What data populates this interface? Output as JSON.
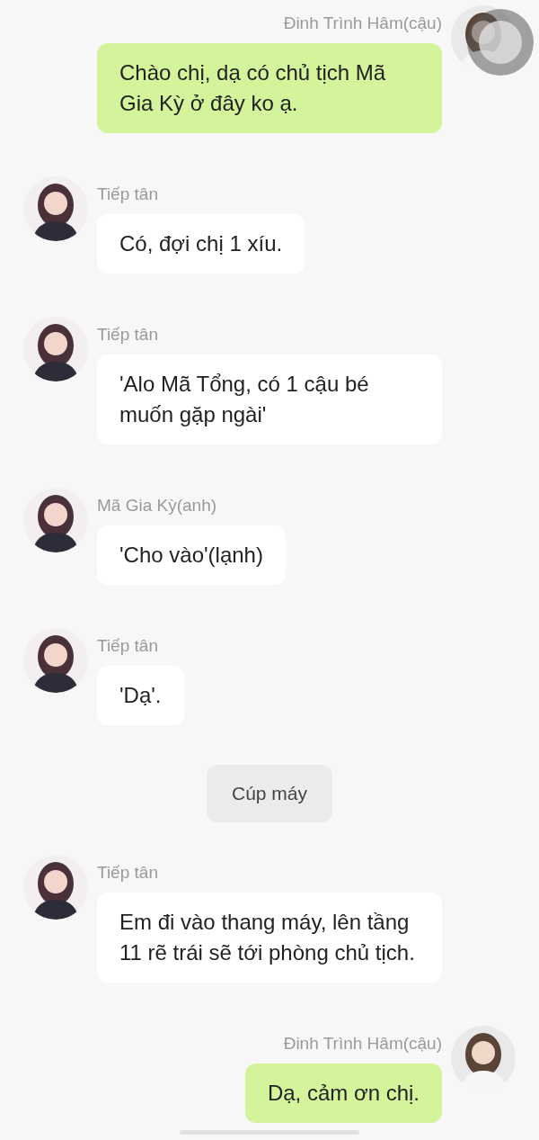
{
  "messages": [
    {
      "kind": "outgoing",
      "sender": "Đinh Trình Hâm(cậu)",
      "text": "Chào chị, dạ có chủ tịch Mã Gia Kỳ ở đây ko ạ."
    },
    {
      "kind": "incoming",
      "sender": "Tiếp tân",
      "text": "Có, đợi chị 1 xíu."
    },
    {
      "kind": "incoming",
      "sender": "Tiếp tân",
      "text": "'Alo Mã Tổng, có 1 cậu bé muốn gặp ngài'"
    },
    {
      "kind": "incoming",
      "sender": "Mã Gia Kỳ(anh)",
      "text": "'Cho vào'(lạnh)"
    },
    {
      "kind": "incoming",
      "sender": "Tiếp tân",
      "text": "'Dạ'."
    },
    {
      "kind": "system",
      "text": "Cúp máy"
    },
    {
      "kind": "incoming",
      "sender": "Tiếp tân",
      "text": "Em đi vào thang máy, lên tầng 11 rẽ trái sẽ tới phòng chủ tịch."
    },
    {
      "kind": "outgoing",
      "sender": "Đinh Trình Hâm(cậu)",
      "text": "Dạ, cảm ơn chị."
    }
  ]
}
